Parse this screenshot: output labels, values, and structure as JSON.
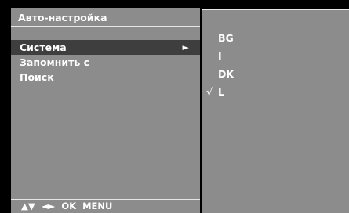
{
  "left_panel": {
    "title": "Авто-настройка",
    "menu_items": [
      {
        "label": "Система",
        "selected": true,
        "arrow": "►"
      },
      {
        "label": "Запомнить с",
        "selected": false,
        "arrow": ""
      },
      {
        "label": "Поиск",
        "selected": false,
        "arrow": ""
      }
    ],
    "nav_hint": {
      "updown": "▲▼",
      "leftright": "◄►",
      "ok": "OK",
      "menu": "MENU"
    }
  },
  "right_panel": {
    "options": [
      {
        "label": "BG",
        "checked": false,
        "check": ""
      },
      {
        "label": "I",
        "checked": false,
        "check": ""
      },
      {
        "label": "DK",
        "checked": false,
        "check": ""
      },
      {
        "label": "L",
        "checked": true,
        "check": "√"
      }
    ]
  },
  "colors": {
    "panel": "#8c8c8c",
    "selected_row": "#3e3e3e",
    "text": "#ffffff",
    "border": "#e6e6e6",
    "background": "#000000"
  }
}
